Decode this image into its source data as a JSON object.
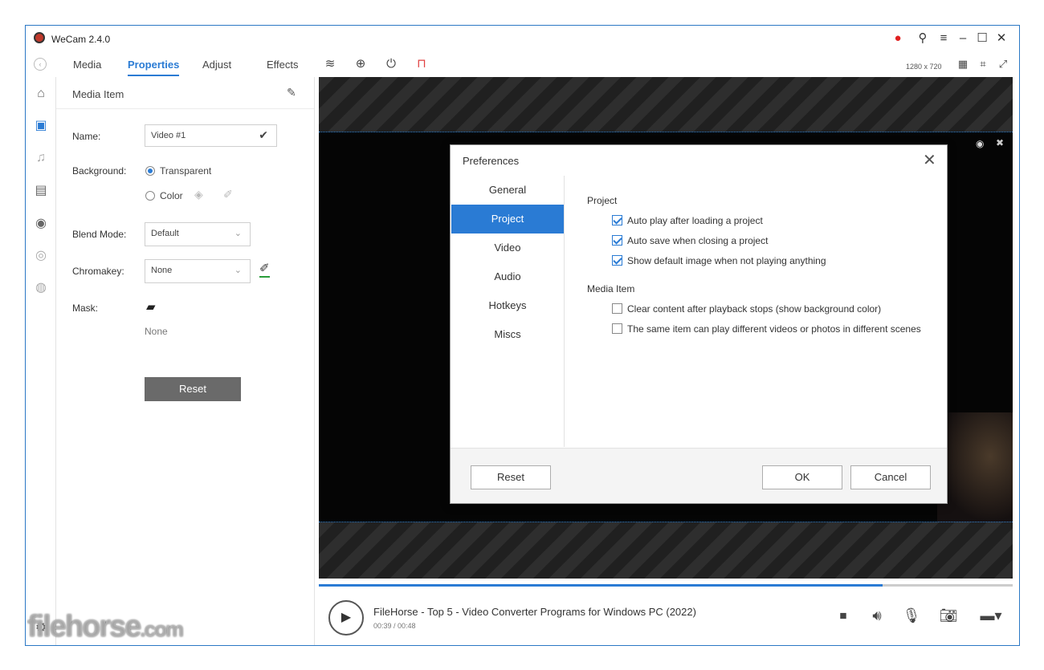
{
  "app": {
    "title": "WeCam 2.4.0"
  },
  "tabs": [
    "Media",
    "Properties",
    "Adjust",
    "Effects"
  ],
  "toolbar": {
    "resolution": "1280 x 720"
  },
  "panel": {
    "header": "Media Item",
    "name_label": "Name:",
    "name_value": "Video #1",
    "background_label": "Background:",
    "bg_transparent": "Transparent",
    "bg_color": "Color",
    "blend_label": "Blend Mode:",
    "blend_value": "Default",
    "chromakey_label": "Chromakey:",
    "chromakey_value": "None",
    "mask_label": "Mask:",
    "mask_value": "None",
    "reset": "Reset"
  },
  "player": {
    "title": "FileHorse - Top 5 - Video Converter Programs for Windows PC (2022)",
    "time": "00:39 / 00:48",
    "progress": 0.8125
  },
  "dialog": {
    "title": "Preferences",
    "nav": [
      "General",
      "Project",
      "Video",
      "Audio",
      "Hotkeys",
      "Miscs"
    ],
    "active_nav": 1,
    "section_project": "Project",
    "project_options": [
      {
        "label": "Auto play after loading a project",
        "checked": true
      },
      {
        "label": "Auto save when closing a project",
        "checked": true
      },
      {
        "label": "Show default image when not playing anything",
        "checked": true
      }
    ],
    "section_media": "Media Item",
    "media_options": [
      {
        "label": "Clear content after playback stops (show background color)",
        "checked": false
      },
      {
        "label": "The same item can play different videos or photos in different scenes",
        "checked": false
      }
    ],
    "reset": "Reset",
    "ok": "OK",
    "cancel": "Cancel"
  },
  "watermark": {
    "main": "filehorse",
    "suffix": ".com"
  },
  "colors": {
    "accent": "#2a7bd4",
    "window_border": "#2b78c5"
  }
}
